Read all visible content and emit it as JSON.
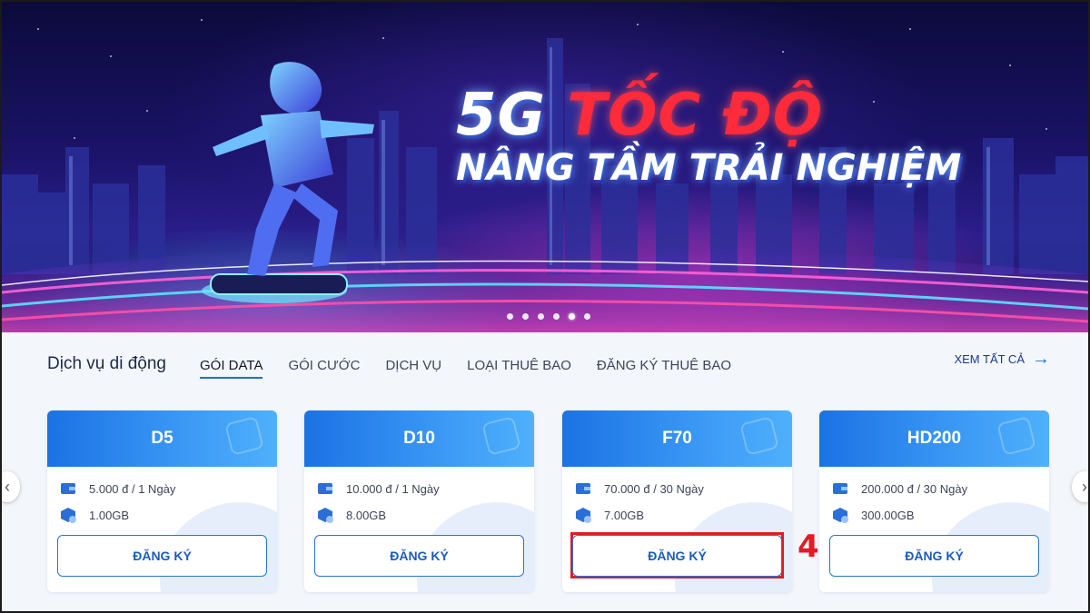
{
  "banner": {
    "title_5g": "5G",
    "title_speed": "TỐC ĐỘ",
    "subtitle": "NÂNG TẦM TRẢI NGHIỆM",
    "slides": [
      {
        "active": false
      },
      {
        "active": false
      },
      {
        "active": false
      },
      {
        "active": false
      },
      {
        "active": true
      },
      {
        "active": false
      }
    ]
  },
  "services": {
    "title": "Dịch vụ di động",
    "tabs": [
      {
        "label": "GÓI DATA",
        "active": true
      },
      {
        "label": "GÓI CƯỚC",
        "active": false
      },
      {
        "label": "DỊCH VỤ",
        "active": false
      },
      {
        "label": "LOẠI THUÊ BAO",
        "active": false
      },
      {
        "label": "ĐĂNG KÝ THUÊ BAO",
        "active": false
      }
    ],
    "view_all": "XEM TẤT CẢ",
    "cards": [
      {
        "name": "D5",
        "price": "5.000 đ / 1 Ngày",
        "data": "1.00GB",
        "button": "ĐĂNG KÝ"
      },
      {
        "name": "D10",
        "price": "10.000 đ / 1 Ngày",
        "data": "8.00GB",
        "button": "ĐĂNG KÝ"
      },
      {
        "name": "F70",
        "price": "70.000 đ / 30 Ngày",
        "data": "7.00GB",
        "button": "ĐĂNG KÝ"
      },
      {
        "name": "HD200",
        "price": "200.000 đ / 30 Ngày",
        "data": "300.00GB",
        "button": "ĐĂNG KÝ"
      }
    ]
  },
  "annotation": {
    "step": "4",
    "color": "#e01c24"
  },
  "colors": {
    "brand_blue": "#1b72e4",
    "hero_bg": "#1a1368"
  }
}
